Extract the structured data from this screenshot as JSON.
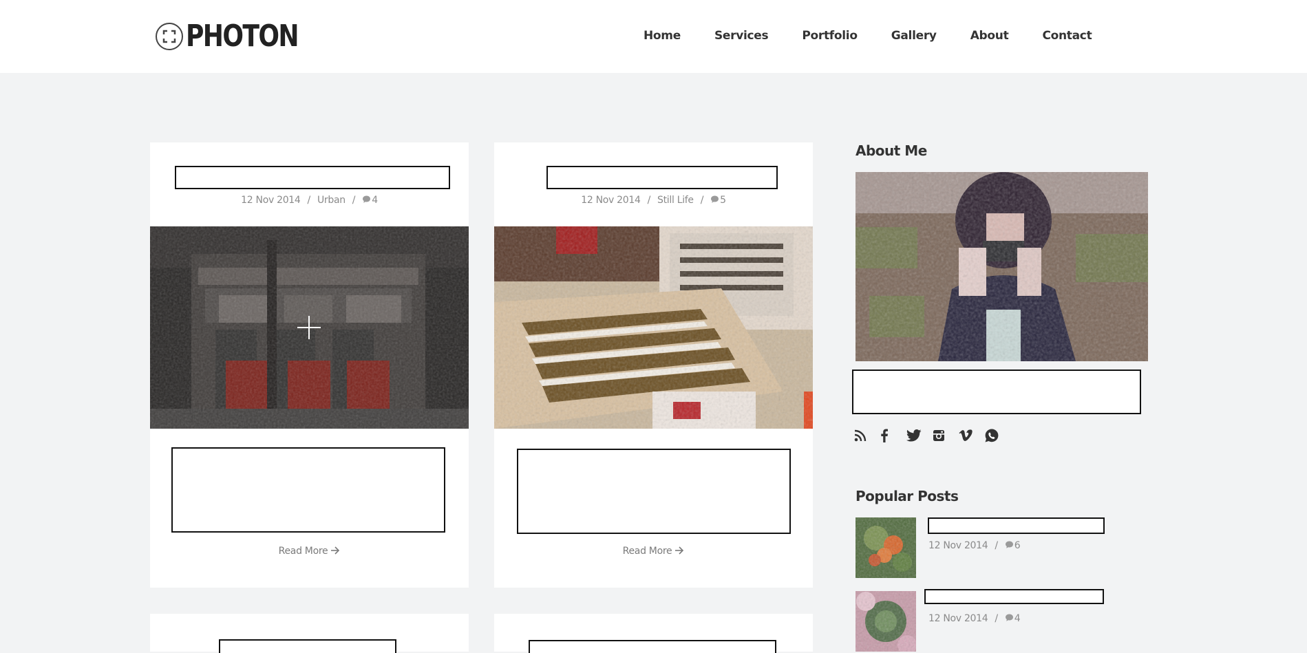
{
  "brand": {
    "name": "PHOTON"
  },
  "nav": {
    "items": [
      {
        "label": "Home"
      },
      {
        "label": "Services"
      },
      {
        "label": "Portfolio"
      },
      {
        "label": "Gallery"
      },
      {
        "label": "About"
      },
      {
        "label": "Contact"
      }
    ]
  },
  "posts": [
    {
      "date": "12 Nov 2014",
      "separator": "/",
      "category": "Urban",
      "comments": "4",
      "read_more": "Read More",
      "image_icon": "plus-crosshair-icon"
    },
    {
      "date": "12 Nov 2014",
      "separator": "/",
      "category": "Still Life",
      "comments": "5",
      "read_more": "Read More"
    }
  ],
  "sidebar": {
    "about_title": "About Me",
    "social_icons": [
      "rss-icon",
      "facebook-icon",
      "twitter-icon",
      "instagram-icon",
      "vimeo-icon",
      "whatsapp-icon"
    ],
    "popular_title": "Popular Posts",
    "popular_posts": [
      {
        "date": "12 Nov 2014",
        "separator": "/",
        "comments": "6"
      },
      {
        "date": "12 Nov 2014",
        "separator": "/",
        "comments": "4"
      }
    ]
  },
  "colors": {
    "page_bg": "#f2f3f4",
    "header_bg": "#ffffff",
    "text_dark": "#333333",
    "text_muted": "#8a8a8a"
  }
}
